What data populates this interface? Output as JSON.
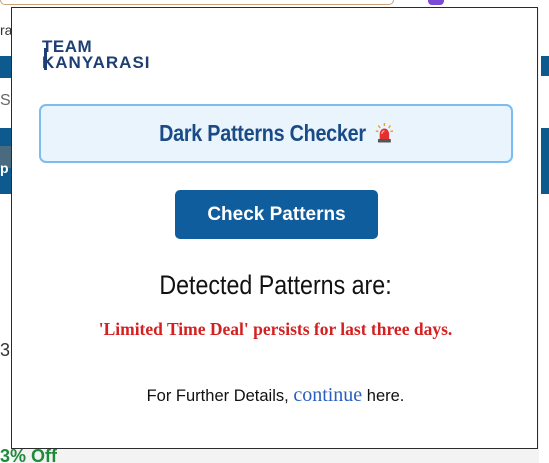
{
  "background": {
    "left_texts": [
      "ra",
      "Se",
      "p",
      "3"
    ],
    "bottom_text": "3% Off"
  },
  "popup": {
    "logo": {
      "line1": "TEAM",
      "line2": "KANYARASI"
    },
    "title": "Dark Patterns Checker",
    "title_icon": "siren-icon",
    "check_button_label": "Check Patterns",
    "detected_heading": "Detected Patterns are:",
    "detected_message": "'Limited Time Deal' persists for last three days.",
    "further_prefix": "For Further Details, ",
    "further_link": "continue",
    "further_suffix": " here.",
    "colors": {
      "brand_navy": "#1e3f73",
      "title_text": "#1b4b86",
      "title_bg": "#e9f4fd",
      "title_border": "#7bbdf0",
      "button_bg": "#0f5d9c",
      "warning_red": "#d42020",
      "link_blue": "#2a5fbf"
    }
  }
}
